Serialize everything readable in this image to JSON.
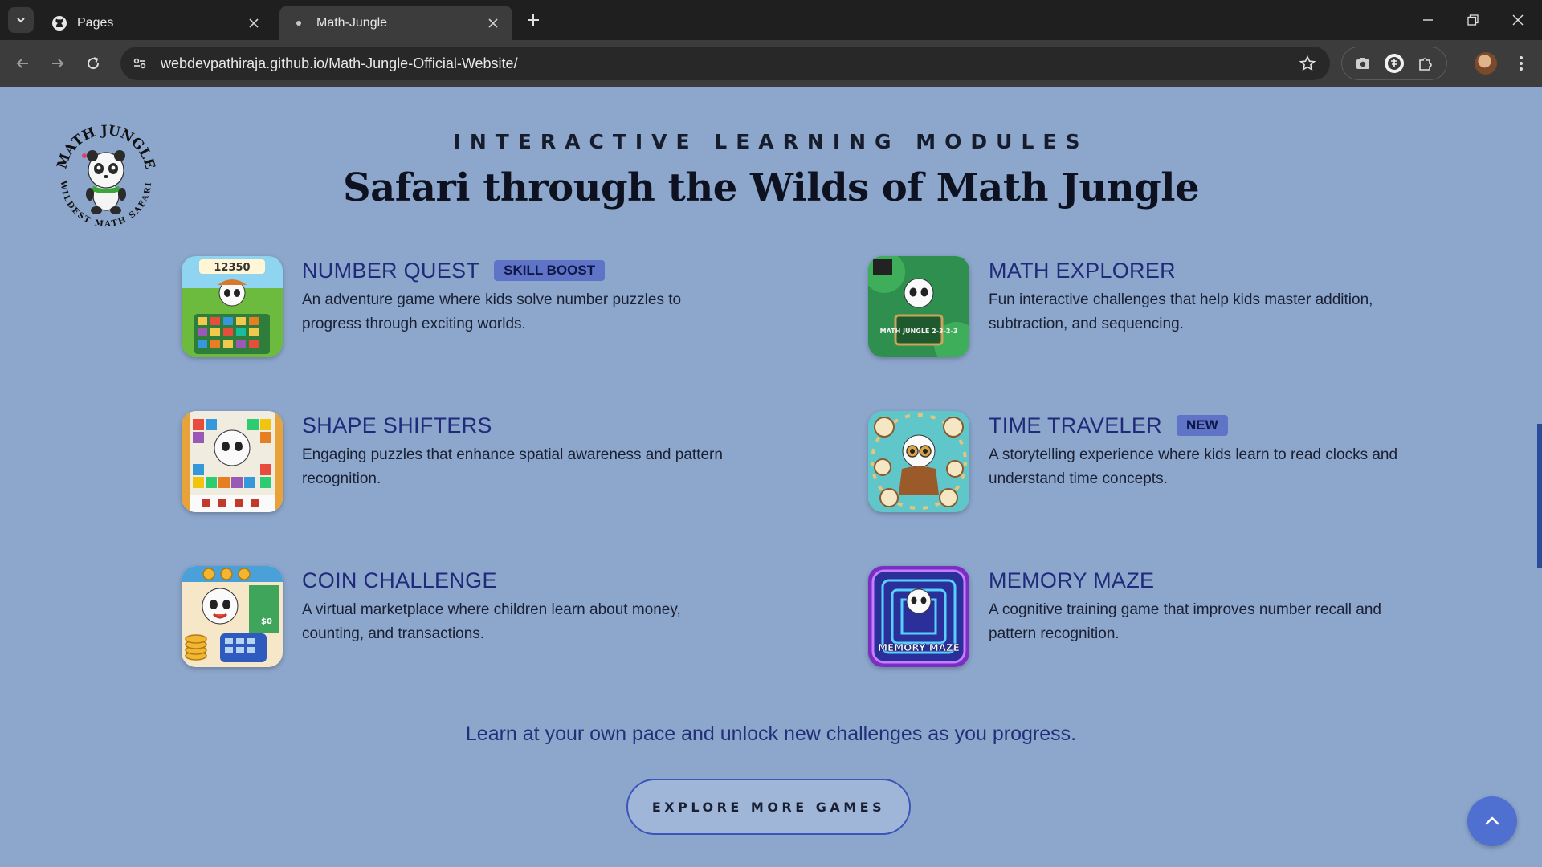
{
  "browser": {
    "tabs": [
      {
        "title": "Pages",
        "favicon": "github-icon",
        "active": false
      },
      {
        "title": "Math-Jungle",
        "favicon": "site-favicon",
        "active": true
      }
    ],
    "url": "webdevpathiraja.github.io/Math-Jungle-Official-Website/"
  },
  "logo": {
    "ring_text_top": "MATH JUNGLE",
    "ring_text_bottom": "WILDEST MATH SAFARI"
  },
  "section": {
    "eyebrow": "INTERACTIVE LEARNING MODULES",
    "headline": "Safari through the Wilds of Math Jungle"
  },
  "games": [
    {
      "title": "NUMBER QUEST",
      "badge": "SKILL BOOST",
      "description": "An adventure game where kids solve number puzzles to progress through exciting worlds.",
      "thumb_text": "12350"
    },
    {
      "title": "MATH EXPLORER",
      "badge": "",
      "description": "Fun interactive challenges that help kids master addition, subtraction, and sequencing.",
      "thumb_text": "MATH JUNGLE 2-3-2-3"
    },
    {
      "title": "SHAPE SHIFTERS",
      "badge": "",
      "description": "Engaging puzzles that enhance spatial awareness and pattern recognition."
    },
    {
      "title": "TIME TRAVELER",
      "badge": "NEW",
      "description": "A storytelling experience where kids learn to read clocks and understand time concepts."
    },
    {
      "title": "COIN CHALLENGE",
      "badge": "",
      "description": "A virtual marketplace where children learn about money, counting, and transactions.",
      "thumb_text": "$0"
    },
    {
      "title": "MEMORY MAZE",
      "badge": "",
      "description": "A cognitive training game that improves number recall and pattern recognition.",
      "thumb_text": "MEMORY MAZE"
    }
  ],
  "tagline": "Learn at your own pace and unlock new challenges as you progress.",
  "cta": {
    "label": "EXPLORE MORE GAMES"
  },
  "colors": {
    "page_bg": "#8ca6cc",
    "title": "#1f2a7a",
    "badge_bg": "#5f73c7",
    "accent": "#4f6fd1"
  }
}
